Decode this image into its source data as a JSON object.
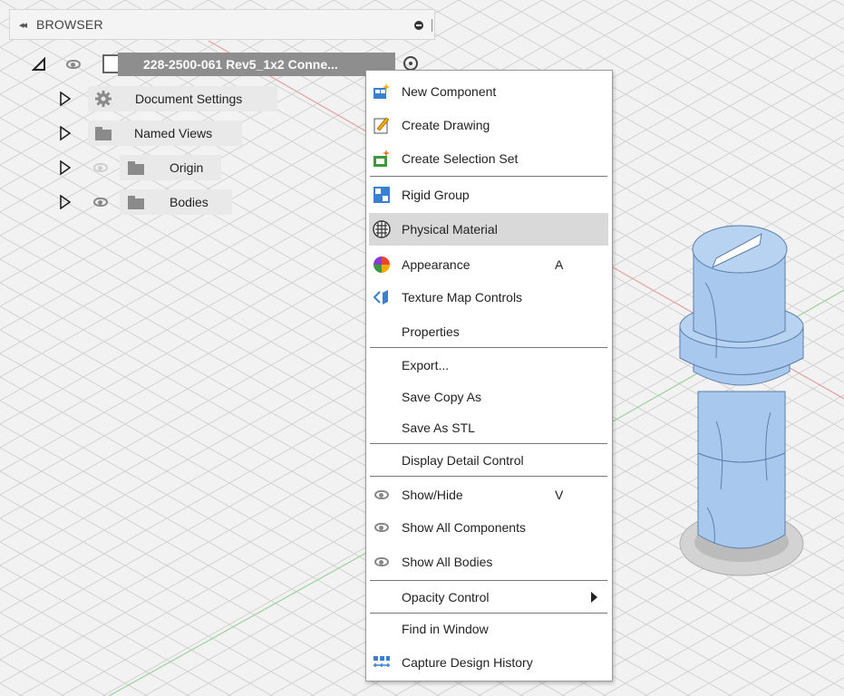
{
  "browser": {
    "collapse_glyph": "◂◂",
    "title": "BROWSER"
  },
  "tree": {
    "root_label": "228-2500-061 Rev5_1x2 Conne...",
    "items": [
      {
        "label": "Document Settings",
        "icon": "gear-icon"
      },
      {
        "label": "Named Views",
        "icon": "folder-icon"
      },
      {
        "label": "Origin",
        "icon": "folder-icon",
        "visible": false
      },
      {
        "label": "Bodies",
        "icon": "folder-icon",
        "visible": true
      }
    ]
  },
  "context_menu": {
    "items": [
      {
        "label": "New Component",
        "icon": "new-component-icon"
      },
      {
        "label": "Create Drawing",
        "icon": "create-drawing-icon"
      },
      {
        "label": "Create Selection Set",
        "icon": "selection-set-icon"
      },
      {
        "label": "Rigid Group",
        "icon": "rigid-group-icon"
      },
      {
        "label": "Physical Material",
        "icon": "physical-material-icon",
        "highlighted": true
      },
      {
        "label": "Appearance",
        "icon": "appearance-icon",
        "shortcut": "A"
      },
      {
        "label": "Texture Map Controls",
        "icon": "texture-map-icon"
      },
      {
        "label": "Properties"
      },
      {
        "label": "Export..."
      },
      {
        "label": "Save Copy As"
      },
      {
        "label": "Save As STL"
      },
      {
        "label": "Display Detail Control"
      },
      {
        "label": "Show/Hide",
        "icon": "eye-icon",
        "shortcut": "V"
      },
      {
        "label": "Show All Components",
        "icon": "eye-icon"
      },
      {
        "label": "Show All Bodies",
        "icon": "eye-icon"
      },
      {
        "label": "Opacity Control",
        "submenu": true
      },
      {
        "label": "Find in Window"
      },
      {
        "label": "Capture Design History",
        "icon": "capture-history-icon"
      }
    ]
  },
  "colors": {
    "model_fill": "#a9c8ee",
    "model_edge": "#5c7ea8",
    "grid_line": "#d3d3d3",
    "highlight": "#d9d9d9",
    "root_row": "#8e8e8e"
  }
}
